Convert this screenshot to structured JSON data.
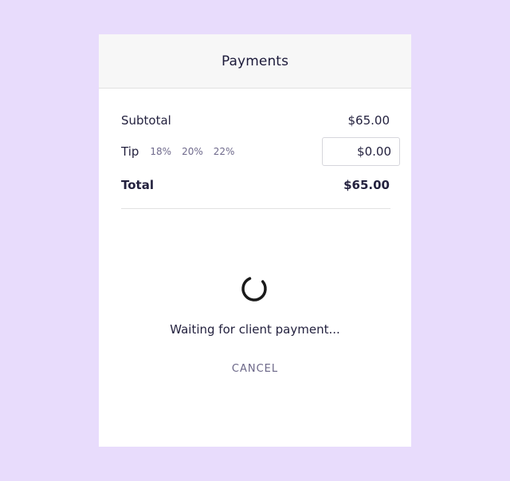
{
  "header": {
    "title": "Payments"
  },
  "summary": {
    "subtotal_label": "Subtotal",
    "subtotal_value": "$65.00",
    "tip_label": "Tip",
    "tip_options": [
      "18%",
      "20%",
      "22%"
    ],
    "tip_value": "$0.00",
    "total_label": "Total",
    "total_value": "$65.00"
  },
  "status": {
    "message": "Waiting for client payment...",
    "cancel_label": "CANCEL"
  },
  "colors": {
    "background": "#e8dcfc",
    "text": "#24223f",
    "muted": "#6f6a8c"
  }
}
